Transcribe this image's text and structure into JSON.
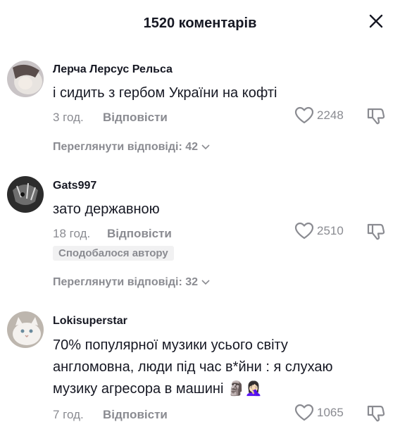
{
  "header": {
    "title": "1520 коментарів",
    "close_icon": "close-icon"
  },
  "comments": [
    {
      "username": "Лерча Лерсус Рельса",
      "lines": [
        "і сидить з гербом України на кофті"
      ],
      "time": "3 год.",
      "reply_label": "Відповісти",
      "likes": "2248",
      "view_replies": "Переглянути відповіді: 42"
    },
    {
      "username": "Gats997",
      "lines": [
        "зато державною"
      ],
      "time": "18 год.",
      "reply_label": "Відповісти",
      "likes": "2510",
      "badge": "Сподобалося автору",
      "view_replies": "Переглянути відповіді: 32"
    },
    {
      "username": "Lokisuperstar",
      "lines": [
        "70% популярної музики усього світу",
        "англомовна, люди під час в*йни : я слухаю",
        "музику агресора в машині 🗿🤦🏻‍♀️"
      ],
      "time": "7 год.",
      "reply_label": "Відповісти",
      "likes": "1065"
    }
  ],
  "colors": {
    "text": "#161823",
    "secondary": "#8a8b91",
    "badge_bg": "#f1f1f2"
  }
}
